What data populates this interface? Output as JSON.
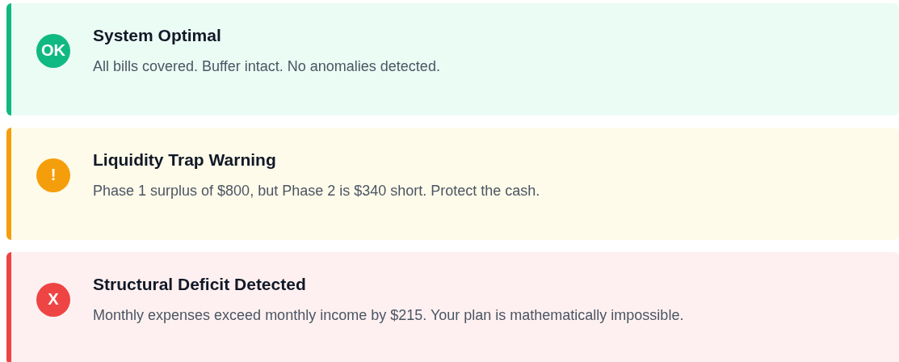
{
  "alerts": [
    {
      "kind": "ok",
      "badge": "OK",
      "title": "System Optimal",
      "message": "All bills covered. Buffer intact. No anomalies detected."
    },
    {
      "kind": "warning",
      "badge": "!",
      "title": "Liquidity Trap Warning",
      "message": "Phase 1 surplus of $800, but Phase 2 is $340 short. Protect the cash."
    },
    {
      "kind": "error",
      "badge": "X",
      "title": "Structural Deficit Detected",
      "message": "Monthly expenses exceed monthly income by $215. Your plan is mathematically impossible."
    }
  ]
}
